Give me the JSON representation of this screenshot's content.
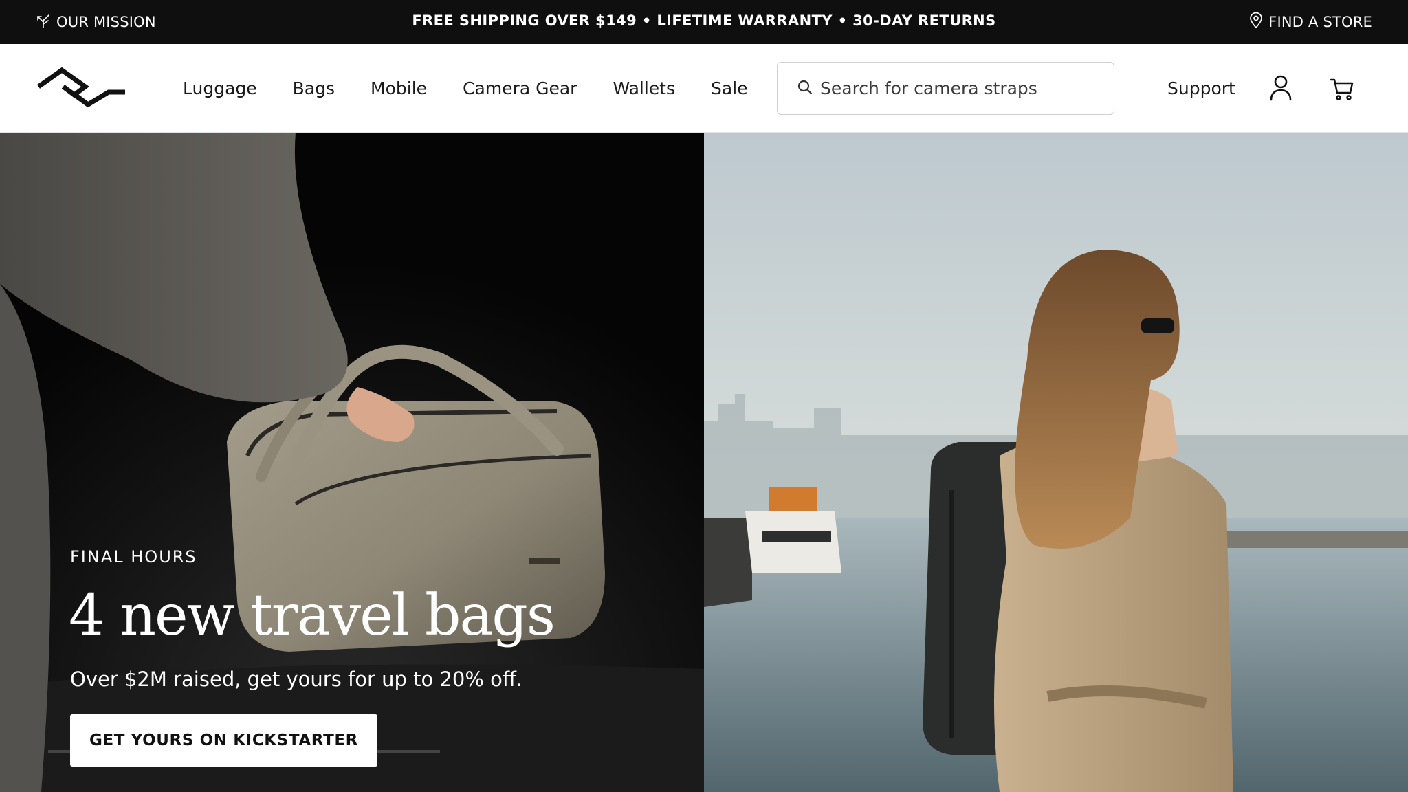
{
  "topbar": {
    "mission_label": "OUR MISSION",
    "mission_icon": "leaf-sprout-icon",
    "promo_text": "FREE SHIPPING OVER $149 • LIFETIME WARRANTY • 30-DAY RETURNS",
    "store_label": "FIND A STORE",
    "store_icon": "map-pin-icon"
  },
  "header": {
    "logo_icon": "peak-design-logo",
    "nav": [
      {
        "label": "Luggage"
      },
      {
        "label": "Bags"
      },
      {
        "label": "Mobile"
      },
      {
        "label": "Camera Gear"
      },
      {
        "label": "Wallets"
      },
      {
        "label": "Sale"
      }
    ],
    "search": {
      "placeholder": "Search for camera straps",
      "icon": "search-icon"
    },
    "support_label": "Support",
    "account_icon": "user-icon",
    "cart_icon": "cart-icon"
  },
  "hero": {
    "eyebrow": "FINAL HOURS",
    "headline": "4 new travel bags",
    "subline": "Over $2M raised, get yours for up to 20% off.",
    "cta_label": "GET YOURS ON KICKSTARTER"
  },
  "colors": {
    "topbar_bg": "#0f0f10",
    "header_bg": "#ffffff",
    "text": "#1a1a1a",
    "cta_bg": "#ffffff"
  }
}
